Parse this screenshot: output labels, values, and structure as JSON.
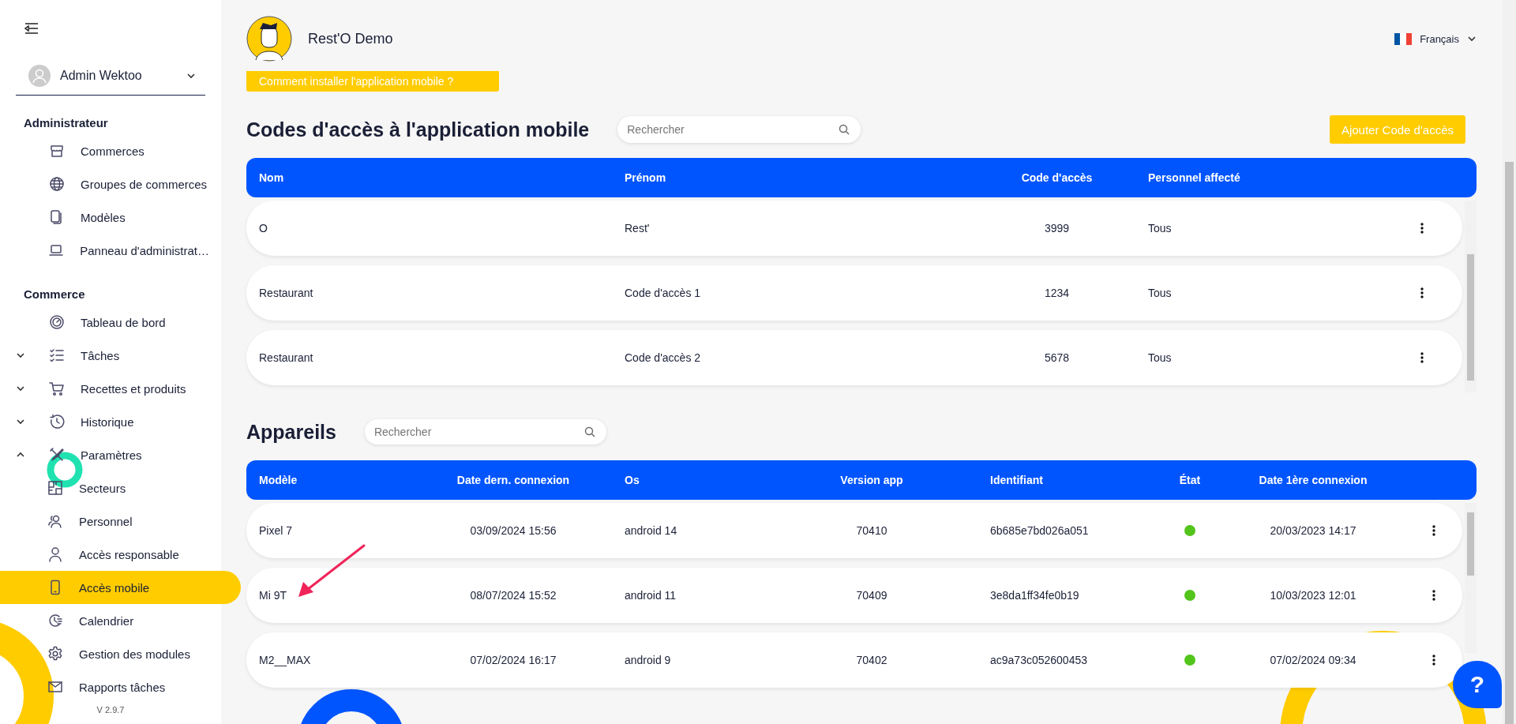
{
  "sidebar": {
    "user": {
      "name": "Admin Wektoo"
    },
    "sections": [
      {
        "title": "Administrateur",
        "items": [
          {
            "label": "Commerces",
            "selected": false
          },
          {
            "label": "Groupes de commerces",
            "selected": false
          },
          {
            "label": "Modèles",
            "selected": false
          },
          {
            "label": "Panneau d'administrat…",
            "selected": false
          }
        ]
      },
      {
        "title": "Commerce",
        "items": [
          {
            "label": "Tableau de bord",
            "selected": false
          },
          {
            "label": "Tâches",
            "selected": false,
            "expanded": false
          },
          {
            "label": "Recettes et produits",
            "selected": false,
            "expanded": false
          },
          {
            "label": "Historique",
            "selected": false,
            "expanded": false
          },
          {
            "label": "Paramètres",
            "selected": false,
            "expanded": true,
            "children": [
              {
                "label": "Secteurs",
                "selected": false
              },
              {
                "label": "Personnel",
                "selected": false
              },
              {
                "label": "Accès responsable",
                "selected": false
              },
              {
                "label": "Accès mobile",
                "selected": true
              },
              {
                "label": "Calendrier",
                "selected": false
              },
              {
                "label": "Gestion des modules",
                "selected": false
              },
              {
                "label": "Rapports tâches",
                "selected": false
              }
            ]
          }
        ]
      }
    ],
    "version": "V 2.9.7"
  },
  "header": {
    "shop_name": "Rest'O Demo",
    "language": "Français"
  },
  "install_button": "Comment installer l'application mobile ?",
  "access_codes": {
    "title": "Codes d'accès à l'application mobile",
    "search": {
      "placeholder": "Rechercher"
    },
    "add_button": "Ajouter Code d'accès",
    "columns": [
      "Nom",
      "Prénom",
      "Code d'accès",
      "Personnel affecté"
    ],
    "rows": [
      {
        "cells": [
          "O",
          "Rest'",
          "3999",
          "Tous"
        ]
      },
      {
        "cells": [
          "Restaurant",
          "Code d'accès 1",
          "1234",
          "Tous"
        ]
      },
      {
        "cells": [
          "Restaurant",
          "Code d'accès 2",
          "5678",
          "Tous"
        ]
      }
    ]
  },
  "devices": {
    "title": "Appareils",
    "search": {
      "placeholder": "Rechercher"
    },
    "columns": [
      "Modèle",
      "Date dern. connexion",
      "Os",
      "Version app",
      "Identifiant",
      "État",
      "Date 1ère connexion"
    ],
    "rows": [
      {
        "model": "Pixel 7",
        "last_connection": "03/09/2024 15:56",
        "os": "android 14",
        "app_version": "70410",
        "identifier": "6b685e7bd026a051",
        "color": "#52c41a",
        "first_connection": "20/03/2023 14:17"
      },
      {
        "model": "Mi 9T",
        "last_connection": "08/07/2024 15:52",
        "os": "android 11",
        "app_version": "70409",
        "identifier": "3e8da1ff34fe0b19",
        "color": "#52c41a",
        "first_connection": "10/03/2023 12:01"
      },
      {
        "model": "M2__MAX",
        "last_connection": "07/02/2024 16:17",
        "os": "android 9",
        "app_version": "70402",
        "identifier": "ac9a73c052600453",
        "color": "#52c41a",
        "first_connection": "07/02/2024 09:34"
      }
    ]
  },
  "help_button": {
    "label": "?"
  }
}
